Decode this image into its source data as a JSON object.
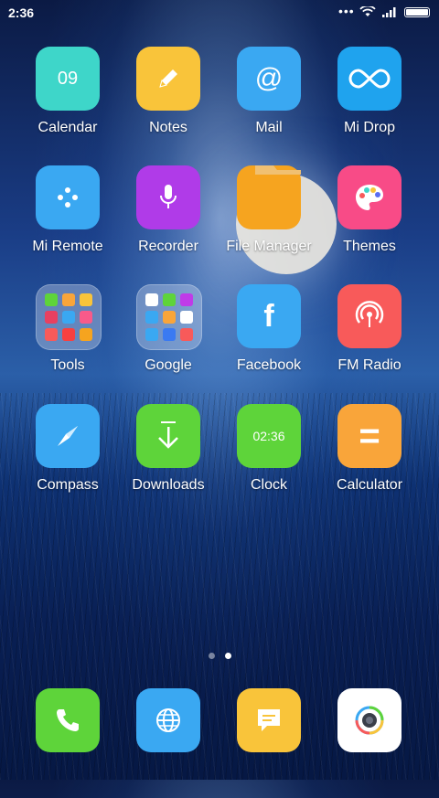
{
  "status_bar": {
    "time": "2:36",
    "more": "•••"
  },
  "apps": [
    {
      "label": "Calendar",
      "icon": "calendar-icon",
      "color": "#3ed6c9",
      "text": "09"
    },
    {
      "label": "Notes",
      "icon": "pencil-icon",
      "color": "#f9c43a"
    },
    {
      "label": "Mail",
      "icon": "at-icon",
      "color": "#3aa8f2",
      "text": "@"
    },
    {
      "label": "Mi Drop",
      "icon": "infinity-icon",
      "color": "#1fa3ee"
    },
    {
      "label": "Mi Remote",
      "icon": "remote-icon",
      "color": "#3aa8f2"
    },
    {
      "label": "Recorder",
      "icon": "microphone-icon",
      "color": "#b03be8"
    },
    {
      "label": "File Manager",
      "icon": "folder-icon",
      "color": "#f6a41f"
    },
    {
      "label": "Themes",
      "icon": "palette-icon",
      "color": "#f84b87"
    },
    {
      "label": "Tools",
      "icon": "folder-tools-icon"
    },
    {
      "label": "Google",
      "icon": "folder-google-icon"
    },
    {
      "label": "Facebook",
      "icon": "facebook-icon",
      "color": "#3aa8f2",
      "text": "f"
    },
    {
      "label": "FM Radio",
      "icon": "radio-icon",
      "color": "#f85a5a"
    },
    {
      "label": "Compass",
      "icon": "compass-icon",
      "color": "#3aa8f2"
    },
    {
      "label": "Downloads",
      "icon": "download-icon",
      "color": "#5ed43a"
    },
    {
      "label": "Clock",
      "icon": "clock-icon",
      "color": "#5ed43a",
      "text": "02:36"
    },
    {
      "label": "Calculator",
      "icon": "calculator-icon",
      "color": "#f9a53a",
      "text": "="
    }
  ],
  "dock": [
    {
      "icon": "phone-icon",
      "color": "#5ed43a"
    },
    {
      "icon": "globe-icon",
      "color": "#3aa8f2"
    },
    {
      "icon": "message-icon",
      "color": "#f9c43a"
    },
    {
      "icon": "camera-icon",
      "color": "#ffffff"
    }
  ],
  "pager": {
    "count": 2,
    "active": 2
  }
}
